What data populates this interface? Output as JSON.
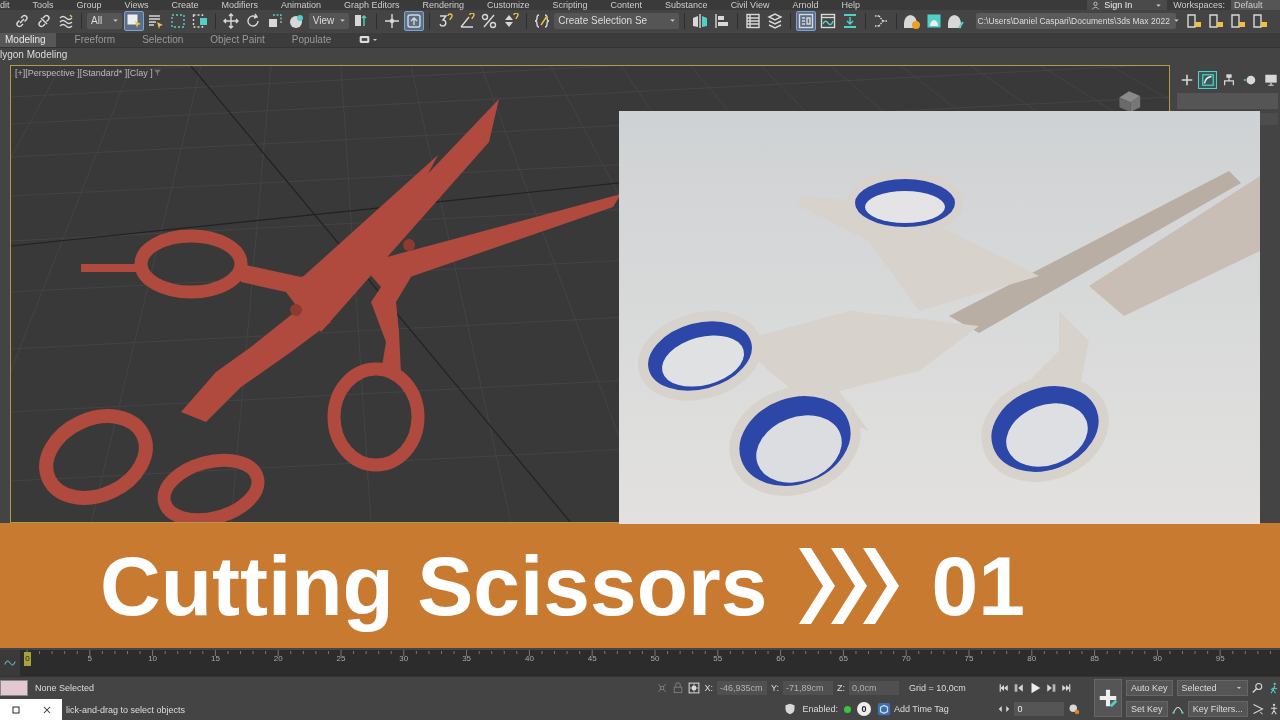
{
  "menu_bar": [
    "dit",
    "Tools",
    "Group",
    "Views",
    "Create",
    "Modifiers",
    "Animation",
    "Graph Editors",
    "Rendering",
    "Customize",
    "Scripting",
    "Content",
    "Substance",
    "Civil View",
    "Arnold",
    "Help"
  ],
  "account": {
    "sign_in": "Sign In",
    "workspaces_label": "Workspaces:",
    "workspace": "Default"
  },
  "toolbar": [
    {
      "kind": "link",
      "selected": false
    },
    {
      "kind": "unlink",
      "selected": false
    },
    {
      "kind": "bind",
      "selected": false
    },
    {
      "kind": "separator"
    },
    {
      "kind": "dropdown",
      "value": "All"
    },
    {
      "kind": "select",
      "selected": true
    },
    {
      "kind": "select-name",
      "selected": false
    },
    {
      "kind": "rect-region",
      "selected": false
    },
    {
      "kind": "crossing",
      "selected": false
    },
    {
      "kind": "separator"
    },
    {
      "kind": "move",
      "selected": false
    },
    {
      "kind": "rotate",
      "selected": false
    },
    {
      "kind": "scale",
      "selected": false
    },
    {
      "kind": "place",
      "selected": false
    },
    {
      "kind": "dropdown",
      "value": "View"
    },
    {
      "kind": "pivot",
      "selected": false
    },
    {
      "kind": "separator"
    },
    {
      "kind": "manipulate",
      "selected": false
    },
    {
      "kind": "shortcut",
      "selected": true
    },
    {
      "kind": "separator"
    },
    {
      "kind": "snap",
      "selected": false
    },
    {
      "kind": "angle",
      "selected": false
    },
    {
      "kind": "percent",
      "selected": false
    },
    {
      "kind": "spinner",
      "selected": false
    },
    {
      "kind": "separator"
    },
    {
      "kind": "named-sel",
      "selected": false
    },
    {
      "kind": "dropdown",
      "value": "Create Selection Se"
    },
    {
      "kind": "separator"
    },
    {
      "kind": "mirror",
      "selected": false
    },
    {
      "kind": "align",
      "selected": false
    },
    {
      "kind": "separator"
    },
    {
      "kind": "scene",
      "selected": false
    },
    {
      "kind": "layer",
      "selected": false
    },
    {
      "kind": "separator"
    },
    {
      "kind": "ribbon",
      "selected": true
    },
    {
      "kind": "curve",
      "selected": false
    },
    {
      "kind": "dope",
      "selected": false
    },
    {
      "kind": "separator"
    },
    {
      "kind": "schematic",
      "selected": false
    },
    {
      "kind": "separator"
    },
    {
      "kind": "material",
      "selected": false
    },
    {
      "kind": "frame",
      "selected": false
    },
    {
      "kind": "render",
      "selected": false
    },
    {
      "kind": "path",
      "value": "C:\\Users\\Daniel Caspari\\Documents\\3ds Max 2022"
    },
    {
      "kind": "project",
      "selected": false
    },
    {
      "kind": "project",
      "selected": false
    },
    {
      "kind": "project",
      "selected": false
    },
    {
      "kind": "project",
      "selected": false
    }
  ],
  "ribbon_tabs": [
    {
      "label": "Modeling",
      "selected": true
    },
    {
      "label": "Freeform",
      "selected": false
    },
    {
      "label": "Selection",
      "selected": false
    },
    {
      "label": "Object Paint",
      "selected": false
    },
    {
      "label": "Populate",
      "selected": false
    }
  ],
  "ribbon_panel": "lygon Modeling",
  "viewport": {
    "labels": [
      "[+]",
      "[Perspective ]",
      "[Standard* ]",
      "[Clay ]"
    ]
  },
  "command_panel": [
    {
      "kind": "create",
      "selected": false
    },
    {
      "kind": "modify",
      "selected": true
    },
    {
      "kind": "hierarchy",
      "selected": false
    },
    {
      "kind": "motion",
      "selected": false
    },
    {
      "kind": "display",
      "selected": false
    }
  ],
  "banner": {
    "title": "Cutting Scissors",
    "episode": "01"
  },
  "timeline": {
    "tick_labels": [
      "5",
      "10",
      "15",
      "20",
      "25",
      "30",
      "35",
      "40",
      "45",
      "50",
      "55",
      "60",
      "65",
      "70",
      "75",
      "80",
      "85",
      "90",
      "95"
    ],
    "slider_label": "0",
    "level": 0
  },
  "status_bar": {
    "selection": "None Selected",
    "prompt": "lick-and-drag to select objects",
    "coordinates": [
      {
        "label": "X:",
        "value": "-46,935cm",
        "disabled": true
      },
      {
        "label": "Y:",
        "value": "-71,89cm",
        "disabled": true
      },
      {
        "label": "Z:",
        "value": "0,0cm",
        "disabled": true
      }
    ],
    "grid": "Grid = 10,0cm",
    "enabled_label": "Enabled:",
    "enabled": true,
    "time_tag_count": "0",
    "add_time_tag": "Add Time Tag",
    "frame": "0",
    "auto_key": "Auto Key",
    "key_set": "Selected",
    "set_key": "Set Key",
    "key_filters": "Key Filters..."
  }
}
